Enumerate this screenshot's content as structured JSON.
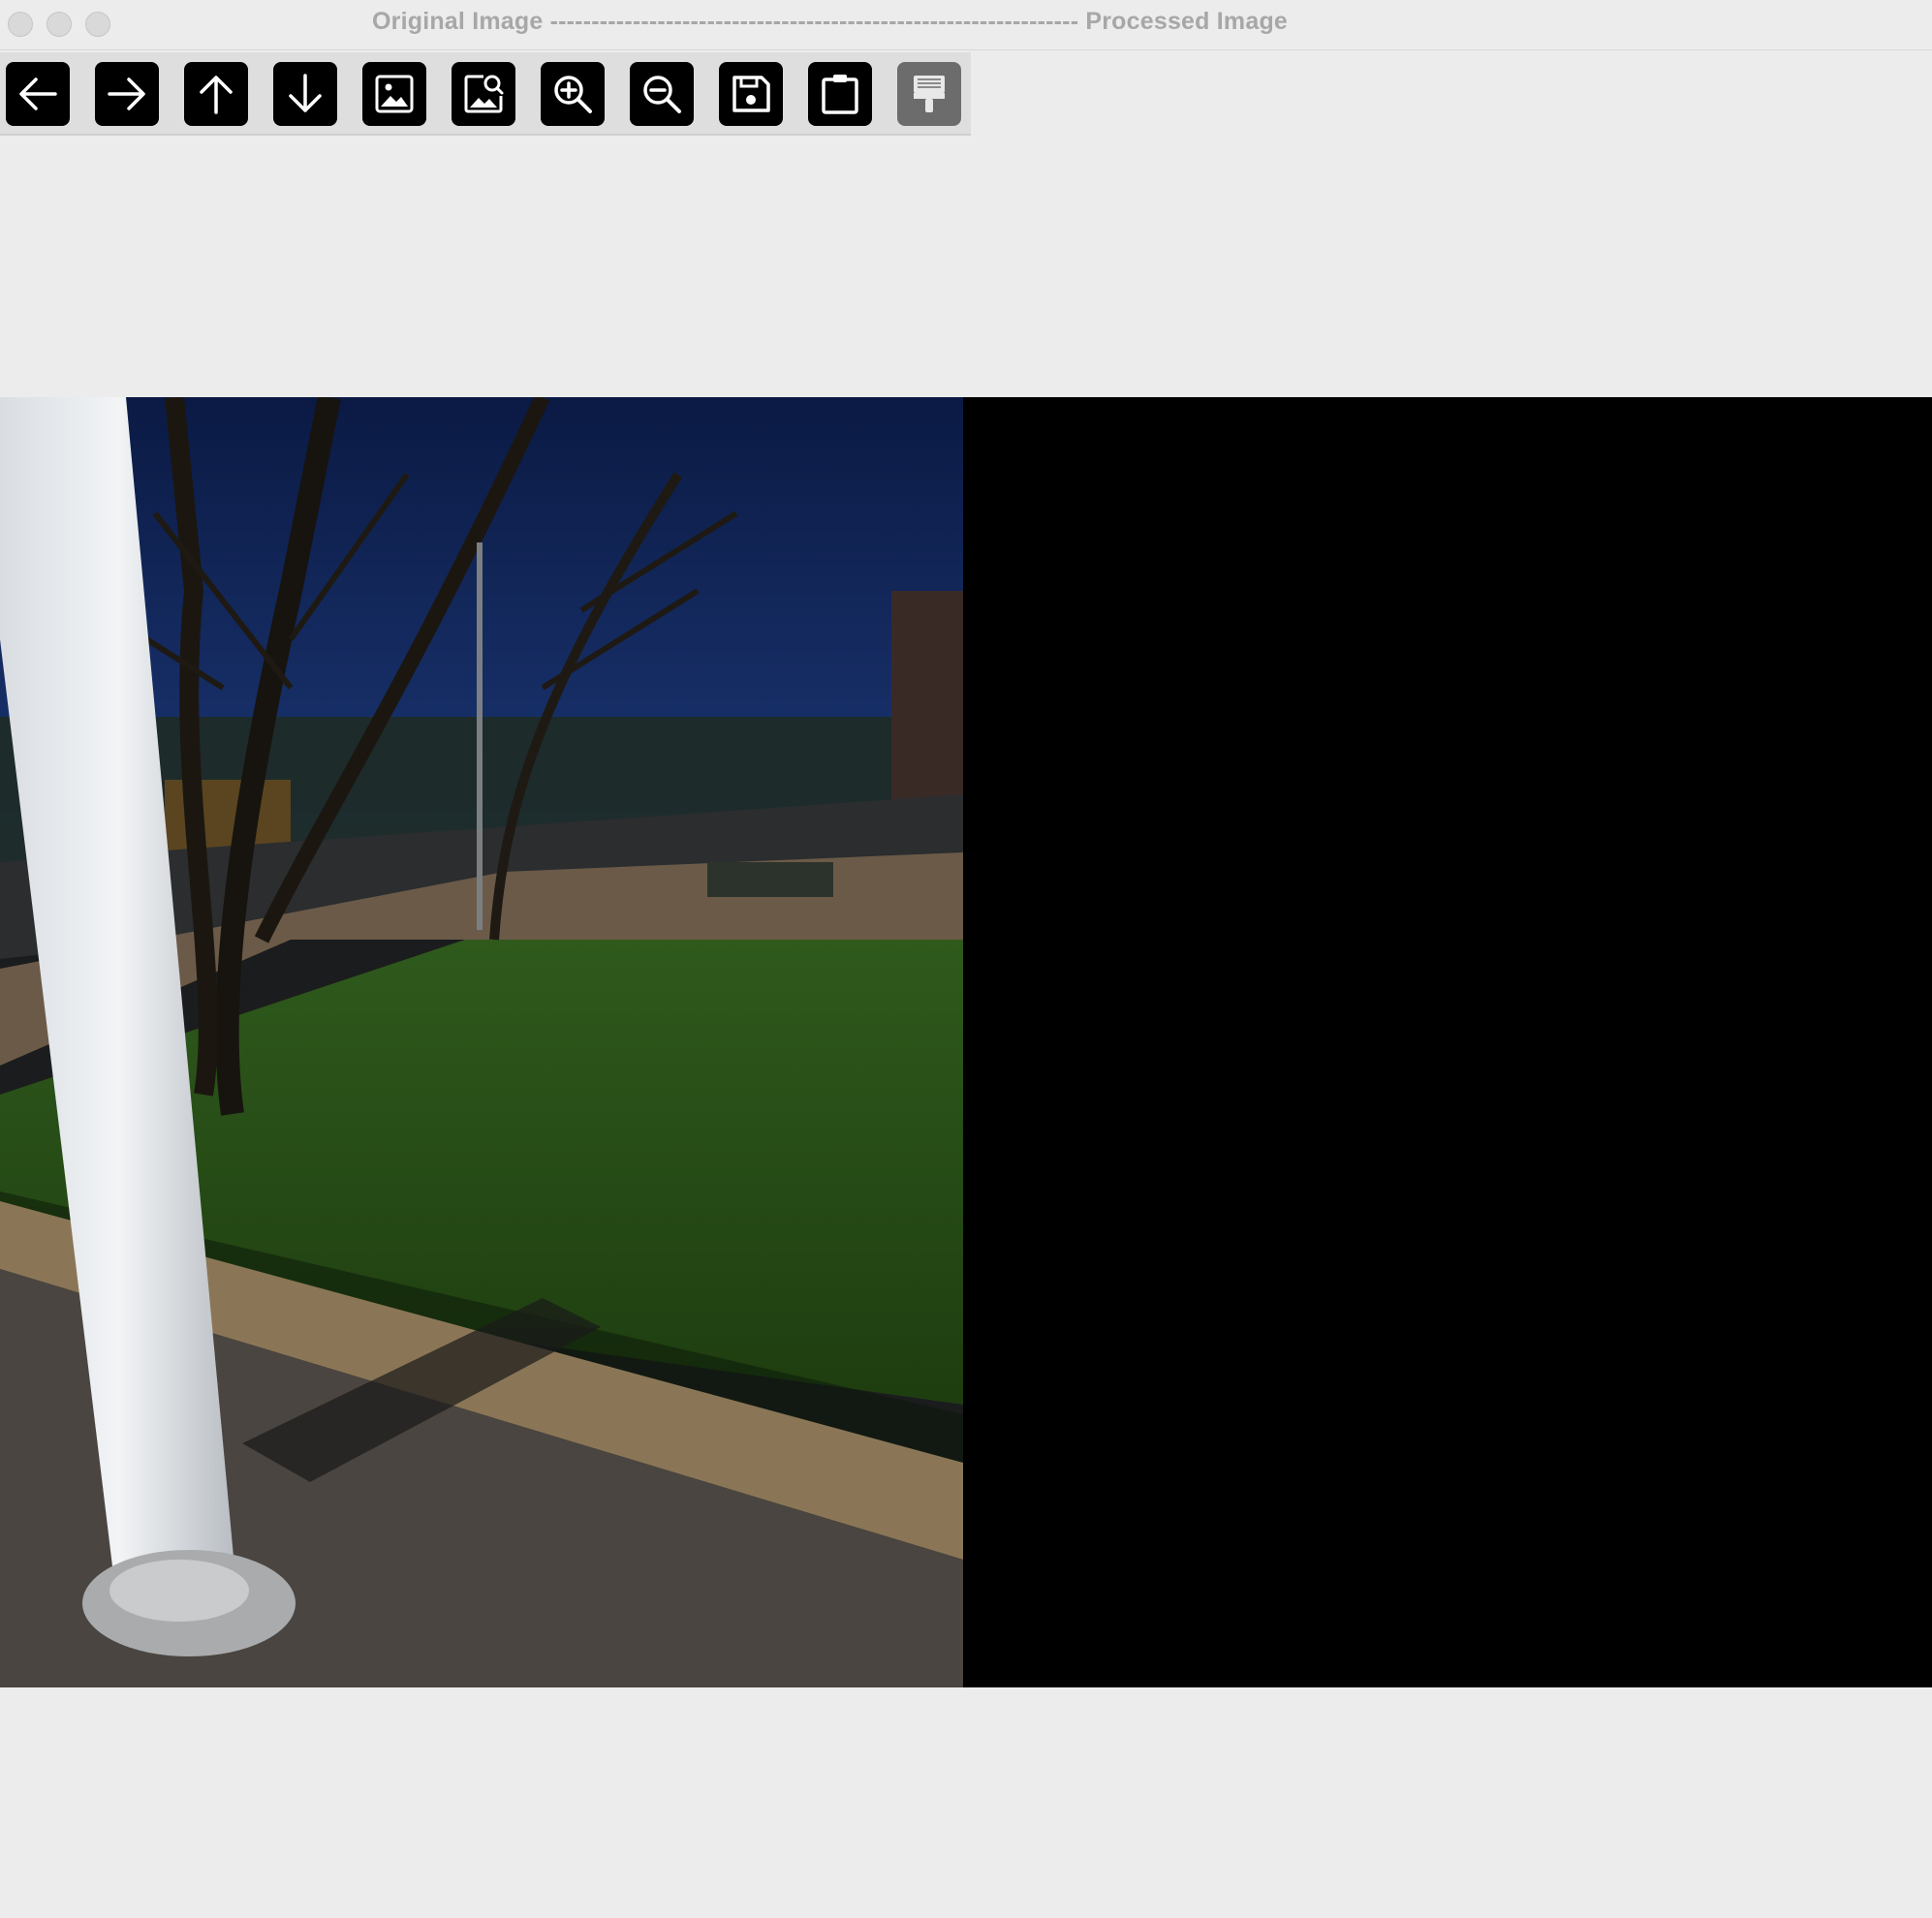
{
  "window": {
    "title": "Original Image ---------------------------------------------------------------- Processed Image"
  },
  "toolbar": {
    "buttons": [
      {
        "name": "back-button",
        "icon": "arrow-left-icon",
        "enabled": true
      },
      {
        "name": "forward-button",
        "icon": "arrow-right-icon",
        "enabled": true
      },
      {
        "name": "up-button",
        "icon": "arrow-up-icon",
        "enabled": true
      },
      {
        "name": "down-button",
        "icon": "arrow-down-icon",
        "enabled": true
      },
      {
        "name": "image-button",
        "icon": "image-icon",
        "enabled": true
      },
      {
        "name": "image-search-button",
        "icon": "image-search-icon",
        "enabled": true
      },
      {
        "name": "zoom-in-button",
        "icon": "zoom-in-icon",
        "enabled": true
      },
      {
        "name": "zoom-out-button",
        "icon": "zoom-out-icon",
        "enabled": true
      },
      {
        "name": "save-button",
        "icon": "save-icon",
        "enabled": true
      },
      {
        "name": "clipboard-button",
        "icon": "clipboard-icon",
        "enabled": true
      },
      {
        "name": "paint-button",
        "icon": "paint-brush-icon",
        "enabled": false
      }
    ]
  },
  "colors": {
    "background": "#ececec",
    "toolbar_bg": "#dedede",
    "button": "#000000",
    "button_disabled": "#6c6c6c",
    "title_text": "#a7a7a7"
  }
}
